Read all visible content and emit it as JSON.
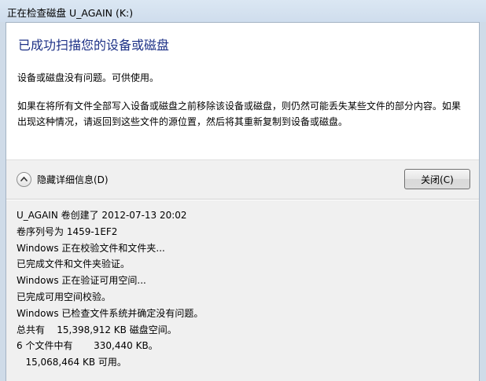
{
  "window": {
    "title": "正在检查磁盘 U_AGAIN (K:)"
  },
  "main": {
    "heading": "已成功扫描您的设备或磁盘",
    "message1": "设备或磁盘没有问题。可供使用。",
    "message2": "如果在将所有文件全部写入设备或磁盘之前移除该设备或磁盘，则仍然可能丢失某些文件的部分内容。如果出现这种情况，请返回到这些文件的源位置，然后将其重新复制到设备或磁盘。"
  },
  "controls": {
    "details_toggle_label": "隐藏详细信息(D)",
    "close_label": "关闭(C)"
  },
  "details": {
    "lines": [
      "U_AGAIN 卷创建了 2012-07-13 20:02",
      "卷序列号为 1459-1EF2",
      "Windows 正在校验文件和文件夹...",
      "已完成文件和文件夹验证。",
      "Windows 正在验证可用空间...",
      "已完成可用空间校验。",
      "Windows 已检查文件系统并确定没有问题。",
      "总共有    15,398,912 KB 磁盘空间。",
      "6 个文件中有       330,440 KB。",
      "   15,068,464 KB 可用。"
    ]
  }
}
